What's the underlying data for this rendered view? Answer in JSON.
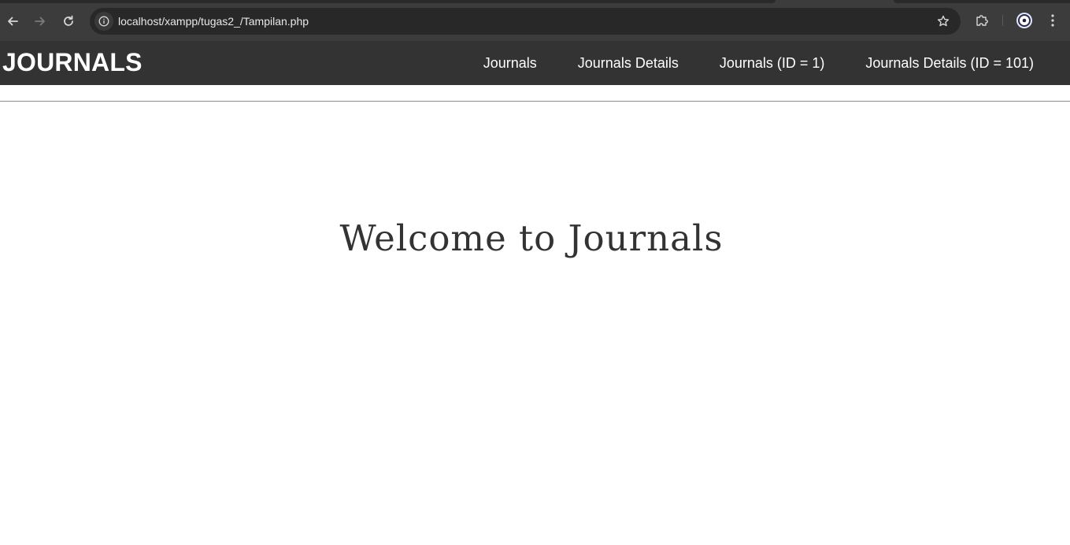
{
  "browser": {
    "url": "localhost/xampp/tugas2_/Tampilan.php",
    "icons": {
      "back": "arrow-left-icon",
      "forward": "arrow-right-icon",
      "reload": "reload-icon",
      "site_info": "info-icon",
      "bookmark": "star-icon",
      "extensions": "puzzle-icon",
      "profile": "profile-icon",
      "menu": "kebab-menu-icon"
    }
  },
  "header": {
    "brand": "JOURNALS",
    "nav": [
      {
        "label": "Journals"
      },
      {
        "label": "Journals Details"
      },
      {
        "label": "Journals (ID = 1)"
      },
      {
        "label": "Journals Details (ID = 101)"
      }
    ]
  },
  "main": {
    "heading": "Welcome to Journals"
  },
  "colors": {
    "header_bg": "#333333",
    "header_text": "#ffffff",
    "heading_text": "#333333"
  }
}
